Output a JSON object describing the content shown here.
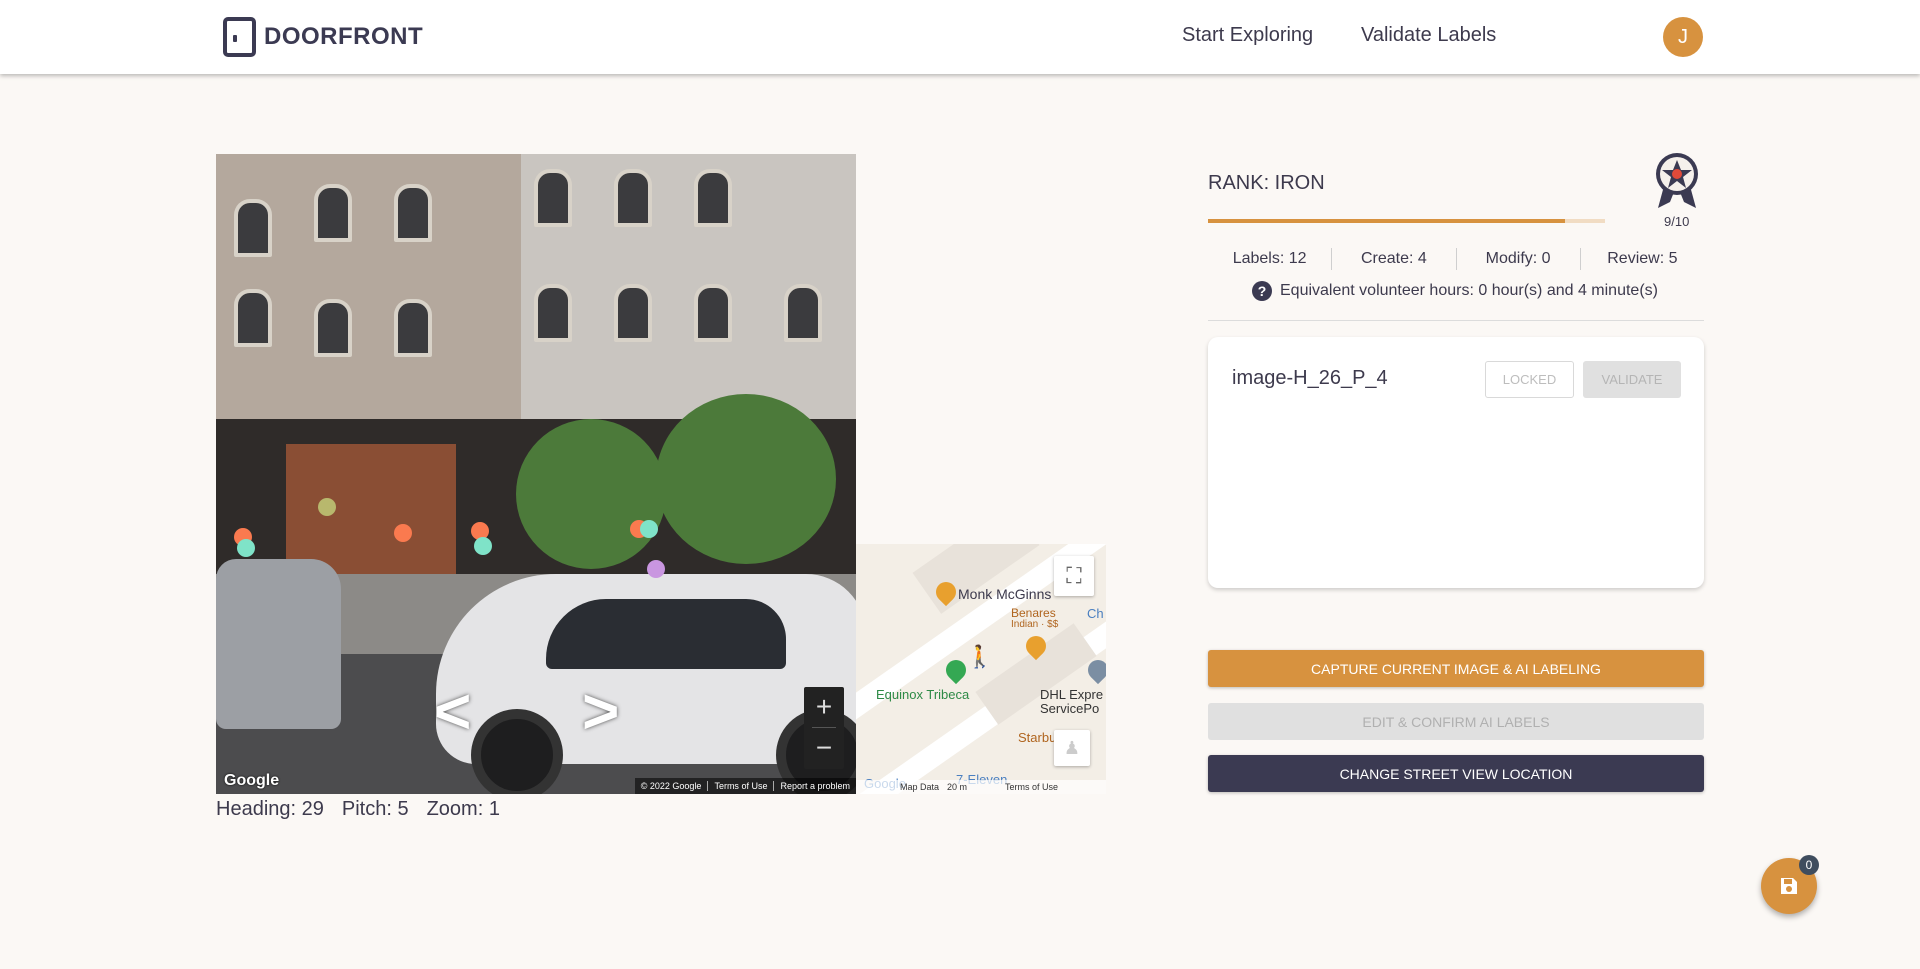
{
  "brand": {
    "name": "DOORFRONT"
  },
  "nav": {
    "explore_label": "Start Exploring",
    "validate_label": "Validate Labels"
  },
  "user": {
    "avatar_initial": "J"
  },
  "streetview": {
    "google_mark": "Google",
    "footer": [
      "© 2022 Google",
      "Terms of Use",
      "Report a problem"
    ],
    "zoom_in": "+",
    "zoom_out": "−",
    "arrow_left": "<",
    "arrow_right": ">"
  },
  "minimap": {
    "labels": [
      "Monk McGinns",
      "Benares",
      "Indian · $$",
      "Equinox Tribeca",
      "DHL Expre",
      "ServicePo",
      "Starbucks",
      "7-Eleven",
      "Ch"
    ],
    "footer": [
      "Map Data",
      "20 m",
      "Terms of Use"
    ],
    "brand": "Google"
  },
  "sv_info": {
    "heading": "Heading: 29",
    "pitch": "Pitch: 5",
    "zoom": "Zoom: 1"
  },
  "rank": {
    "title": "RANK: IRON",
    "count": "9/10",
    "progress": 0.9
  },
  "stats": {
    "labels": "Labels: 12",
    "create": "Create: 4",
    "modify": "Modify: 0",
    "review": "Review: 5"
  },
  "hours": "Equivalent volunteer hours: 0 hour(s) and 4 minute(s)",
  "card": {
    "image_id": "image-H_26_P_4",
    "locked_label": "LOCKED",
    "validate_label": "VALIDATE"
  },
  "actions": {
    "capture": "CAPTURE CURRENT IMAGE & AI LABELING",
    "edit": "EDIT & CONFIRM AI LABELS",
    "change": "CHANGE STREET VIEW LOCATION"
  },
  "fab": {
    "badge": "0"
  },
  "colors": {
    "accent": "#d7923f",
    "dark": "#3b3a52",
    "background": "#fbf8f5"
  }
}
